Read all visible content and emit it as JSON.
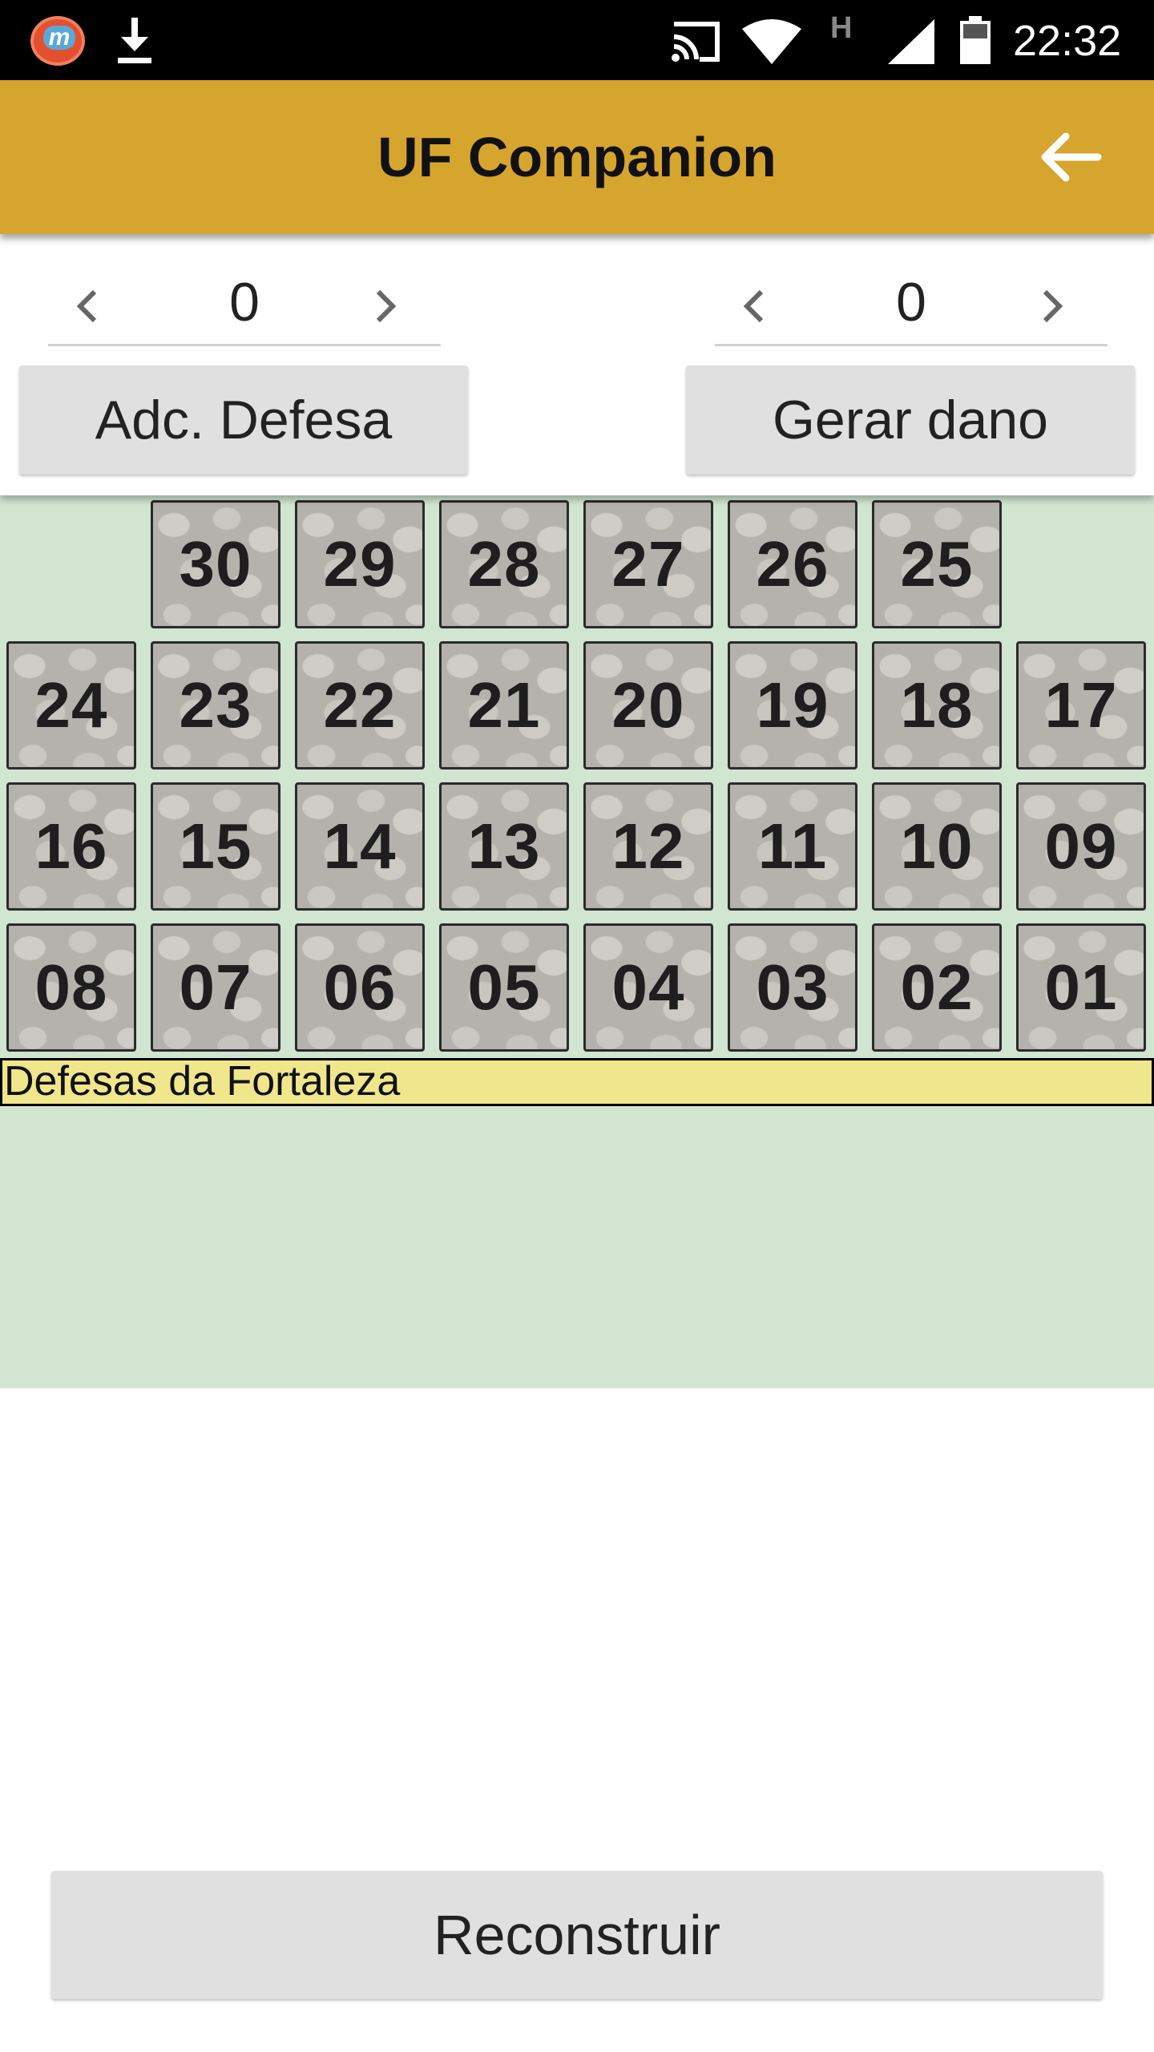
{
  "status_bar": {
    "time": "22:32",
    "app_icon_letter": "m",
    "network_letter": "H",
    "icons": [
      "app-notification-icon",
      "download-icon",
      "cast-icon",
      "wifi-icon",
      "signal-icon",
      "battery-icon"
    ]
  },
  "app_bar": {
    "title": "UF Companion",
    "back_icon": "arrow-left-icon",
    "color": "#d6a52d"
  },
  "controls": {
    "defense_stepper": {
      "value": "0"
    },
    "damage_stepper": {
      "value": "0"
    },
    "add_defense_label": "Adc. Defesa",
    "generate_damage_label": "Gerar dano"
  },
  "board": {
    "background": "#d1e5d1",
    "rows": [
      [
        "30",
        "29",
        "28",
        "27",
        "26",
        "25"
      ],
      [
        "24",
        "23",
        "22",
        "21",
        "20",
        "19",
        "18",
        "17"
      ],
      [
        "16",
        "15",
        "14",
        "13",
        "12",
        "11",
        "10",
        "09"
      ],
      [
        "08",
        "07",
        "06",
        "05",
        "04",
        "03",
        "02",
        "01"
      ]
    ],
    "info_text": "Defesas da Fortaleza",
    "info_color": "#f0e68c"
  },
  "footer": {
    "rebuild_label": "Reconstruir"
  }
}
